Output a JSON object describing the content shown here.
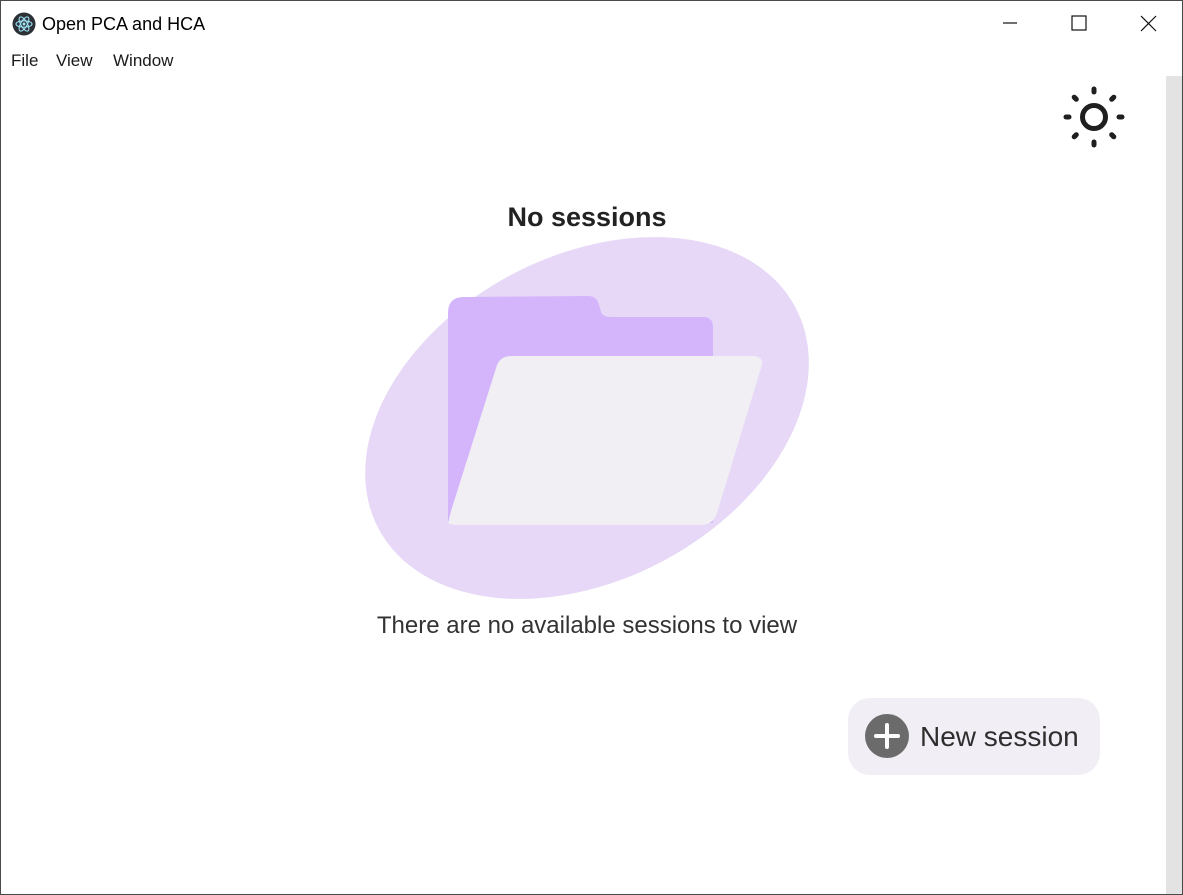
{
  "window": {
    "title": "Open PCA and HCA",
    "controls": {
      "minimize_icon": "minimize-icon",
      "maximize_icon": "maximize-icon",
      "close_icon": "close-icon"
    }
  },
  "menubar": {
    "items": [
      {
        "label": "File"
      },
      {
        "label": "View"
      },
      {
        "label": "Window"
      }
    ]
  },
  "header": {
    "theme_toggle_icon": "sun-icon"
  },
  "empty_state": {
    "title": "No sessions",
    "message": "There are no available sessions to view",
    "illustration_icon": "folder-icon"
  },
  "actions": {
    "new_session_label": "New session",
    "new_session_icon": "plus-circle-icon"
  },
  "colors": {
    "blob": "#e6d8f6",
    "folder_back": "#d4b5fb",
    "folder_front": "#f1eff4",
    "button_bg": "#f1eff5",
    "plus_circle": "#6b6b6b",
    "scrollbar": "#e3e3e3"
  }
}
